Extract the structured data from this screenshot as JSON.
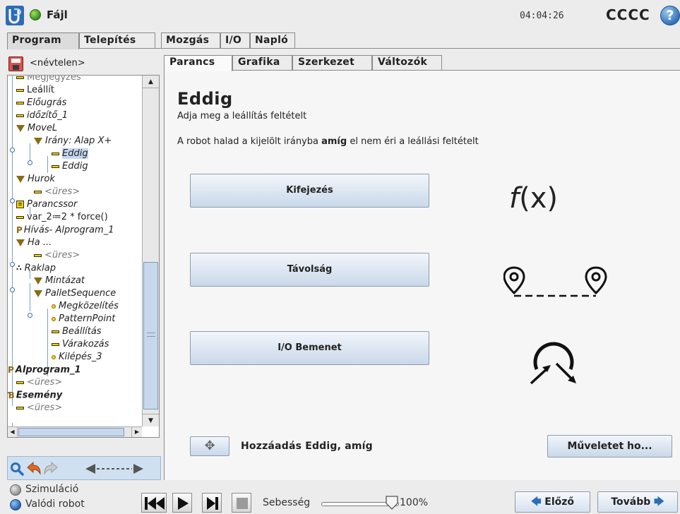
{
  "app": {
    "title": "Fájl",
    "clock": "04:04:26",
    "robot_name": "CCCC",
    "help_label": "?"
  },
  "main_tabs": [
    {
      "label": "Program",
      "active": true
    },
    {
      "label": "Telepítés",
      "active": false
    },
    {
      "label": "Mozgás",
      "active": false
    },
    {
      "label": "I/O",
      "active": false
    },
    {
      "label": "Napló",
      "active": false
    }
  ],
  "program": {
    "name": "<névtelen>"
  },
  "tree": [
    {
      "label": "Megjegyzés",
      "icon": "dash-icon",
      "style": "grey"
    },
    {
      "label": "Leállít",
      "icon": "dash-icon",
      "style": "normal"
    },
    {
      "label": "Előugrás",
      "icon": "dash-icon",
      "style": "italic"
    },
    {
      "label": "időzítő_1",
      "icon": "dash-icon",
      "style": "italic"
    },
    {
      "label": "MoveL",
      "icon": "triangle-icon",
      "style": "italic"
    },
    {
      "label": "Irány: Alap X+",
      "icon": "triangle-icon",
      "style": "italic"
    },
    {
      "label": "Eddig",
      "icon": "dash-icon",
      "style": "italic",
      "selected": true
    },
    {
      "label": "Eddig",
      "icon": "dash-icon",
      "style": "italic"
    },
    {
      "label": "Hurok",
      "icon": "triangle-icon",
      "style": "italic"
    },
    {
      "label": "<üres>",
      "icon": "dash-icon",
      "style": "grey-italic"
    },
    {
      "label": "Parancssor",
      "icon": "script-icon",
      "style": "italic"
    },
    {
      "label": "var_2≔2 * force()",
      "icon": "dash-icon",
      "style": "normal"
    },
    {
      "label": "Hívás- Alprogram_1",
      "icon": "call-icon",
      "style": "italic"
    },
    {
      "label": "Ha ...",
      "icon": "triangle-icon",
      "style": "italic"
    },
    {
      "label": "<üres>",
      "icon": "dash-icon",
      "style": "grey-italic"
    },
    {
      "label": "Raklap",
      "icon": "pallet-icon",
      "style": "italic"
    },
    {
      "label": "Mintázat",
      "icon": "triangle-icon",
      "style": "italic"
    },
    {
      "label": "PalletSequence",
      "icon": "triangle-icon",
      "style": "italic"
    },
    {
      "label": "Megközelítés",
      "icon": "waypoint-icon",
      "style": "italic"
    },
    {
      "label": "PatternPoint",
      "icon": "waypoint-icon",
      "style": "italic"
    },
    {
      "label": "Beállítás",
      "icon": "dash-icon",
      "style": "italic"
    },
    {
      "label": "Várakozás",
      "icon": "dash-icon",
      "style": "italic"
    },
    {
      "label": "Kilépés_3",
      "icon": "waypoint-icon",
      "style": "italic"
    },
    {
      "label": "Alprogram_1",
      "icon": "call-icon",
      "style": "bold-italic"
    },
    {
      "label": "<üres>",
      "icon": "dash-icon",
      "style": "grey-italic"
    },
    {
      "label": "Esemény",
      "icon": "event-icon",
      "style": "bold-italic"
    },
    {
      "label": "<üres>",
      "icon": "dash-icon",
      "style": "grey-italic"
    }
  ],
  "sub_tabs": [
    {
      "label": "Parancs",
      "active": true
    },
    {
      "label": "Grafika",
      "active": false
    },
    {
      "label": "Szerkezet",
      "active": false
    },
    {
      "label": "Változók",
      "active": false
    }
  ],
  "command": {
    "title": "Eddig",
    "subtitle": "Adja meg a leállítás feltételt",
    "desc_before": "A robot halad a kijelölt irányba ",
    "desc_bold": "amíg",
    "desc_after": " el nem éri a leállási feltételt",
    "options": [
      {
        "label": "Kifejezés",
        "icon": "function-icon"
      },
      {
        "label": "Távolság",
        "icon": "distance-icon"
      },
      {
        "label": "I/O Bemenet",
        "icon": "io-input-icon"
      }
    ],
    "fx_f": "f",
    "fx_rest": "(x)",
    "add_symbol": "✥",
    "add_label": "Hozzáadás Eddig, amíg",
    "action_label": "Műveletet ho..."
  },
  "footer": {
    "simulation_label": "Szimuláció",
    "real_robot_label": "Valódi robot",
    "mode_selected": "real",
    "speed_label": "Sebesség",
    "speed_value": "100%",
    "speed_fraction": 1.0,
    "prev_label": "Előző",
    "next_label": "Tovább"
  },
  "colors": {
    "accent": "#2d6db7",
    "button_top": "#f2f6fb",
    "button_bottom": "#c9d8ea",
    "selection": "#c6d8f0",
    "tree_icon": "#f2d100"
  }
}
